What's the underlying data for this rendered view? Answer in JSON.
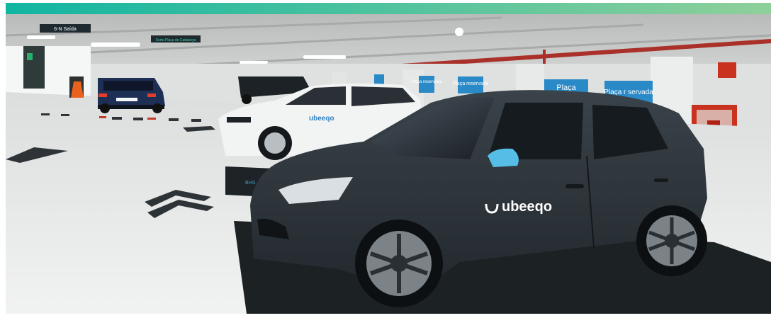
{
  "colors": {
    "banner_left": "#11b5a2",
    "banner_right": "#8fd09a",
    "ceiling": "#c9cbc9",
    "floor": "#e9eaea",
    "wall": "#e0e2e1",
    "sign_blue": "#2a8ac7",
    "car_dark": "#2b3238",
    "car_white": "#f2f3f3",
    "mirror_blue": "#56bde6",
    "pipe_red": "#a9312a",
    "extinguisher_red": "#c8321f"
  },
  "photo": {
    "ceiling_sign": "6-N Saída",
    "ceiling_sign_secondary": "Sorte Plaça de Catalunya",
    "wall_sign_1": "Plaça reservada",
    "wall_sign_2": "Plaça reservada",
    "wall_sign_3": "Plaça",
    "wall_sign_4": "Plaça r servada",
    "wall_sign_5": "Plaça",
    "main_car_logo": "ubeeqo",
    "white_car_logo": "ubeeqo",
    "main_car_plate": "",
    "floor_marker": "BHS"
  }
}
